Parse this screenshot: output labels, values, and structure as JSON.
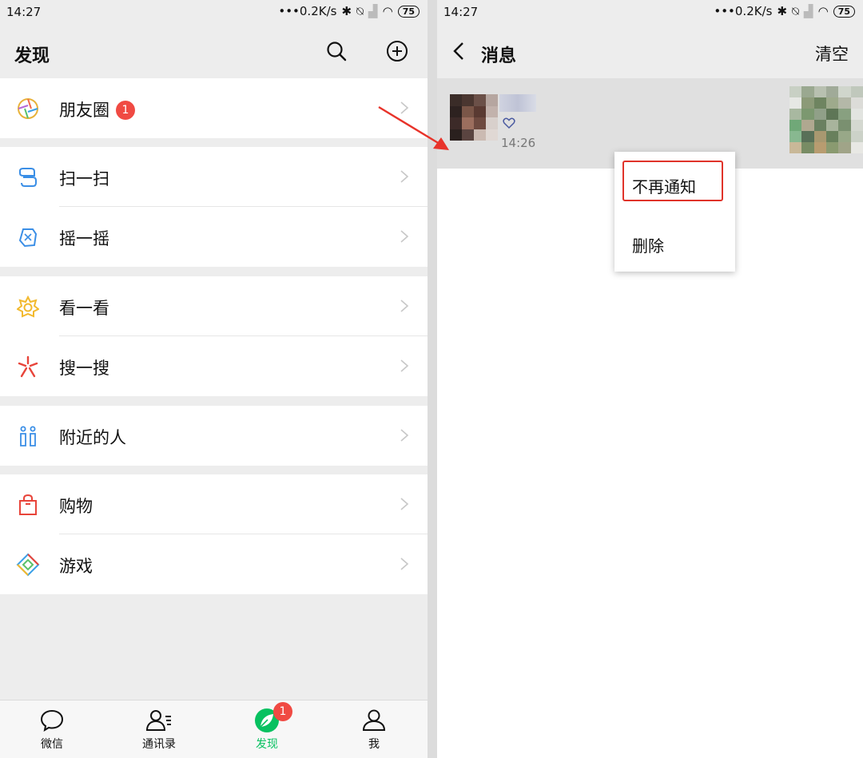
{
  "left": {
    "status": {
      "time": "14:27",
      "rate": "0.2K/s",
      "battery": "75"
    },
    "title": "发现",
    "search_icon": "search-icon",
    "add_icon": "plus-circle-icon",
    "items": [
      {
        "label": "朋友圈",
        "badge": "1",
        "icon": "moments-icon"
      },
      {
        "label": "扫一扫",
        "icon": "scan-icon"
      },
      {
        "label": "摇一摇",
        "icon": "shake-icon"
      },
      {
        "label": "看一看",
        "icon": "top-stories-icon"
      },
      {
        "label": "搜一搜",
        "icon": "search-feature-icon"
      },
      {
        "label": "附近的人",
        "icon": "people-nearby-icon"
      },
      {
        "label": "购物",
        "icon": "shopping-bag-icon"
      },
      {
        "label": "游戏",
        "icon": "games-icon"
      }
    ],
    "tabs": [
      {
        "label": "微信",
        "icon": "chat-bubble-icon"
      },
      {
        "label": "通讯录",
        "icon": "contacts-icon"
      },
      {
        "label": "发现",
        "icon": "discover-icon",
        "badge": "1",
        "active": true
      },
      {
        "label": "我",
        "icon": "me-icon"
      }
    ],
    "accent": "#07c160",
    "badge_color": "#f04a43"
  },
  "right": {
    "status": {
      "time": "14:27",
      "rate": "0.2K/s",
      "battery": "75"
    },
    "title": "消息",
    "clear": "清空",
    "message": {
      "time": "14:26",
      "reaction": "heart-icon"
    },
    "menu": [
      {
        "label": "不再通知",
        "highlighted": true
      },
      {
        "label": "删除"
      }
    ],
    "highlight_color": "#e0332a"
  }
}
